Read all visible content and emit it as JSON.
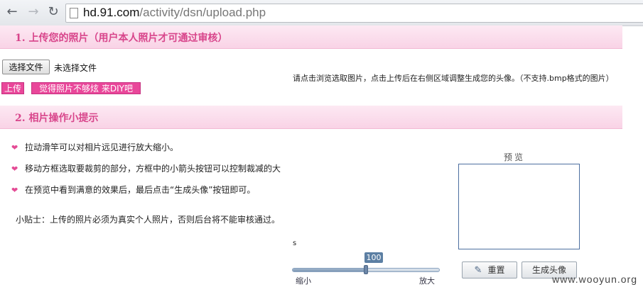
{
  "browser": {
    "url_domain": "hd.91.com",
    "url_path": "/activity/dsn/upload.php",
    "back_icon": "back-arrow",
    "forward_icon": "forward-arrow",
    "reload_icon": "reload"
  },
  "section1": {
    "title": "1. 上传您的照片（用户本人照片才可通过审核）"
  },
  "upload": {
    "choose_file_label": "选择文件",
    "file_status": "未选择文件",
    "upload_label": "上传",
    "diy_label": "觉得照片不够炫 来DIY吧",
    "hint": "请点击浏览选取图片，点击上传后在右侧区域调整生成您的头像。（不支持.bmp格式的图片）"
  },
  "section2": {
    "title": "2. 相片操作小提示"
  },
  "tips": [
    "拉动滑竿可以对相片远见进行放大缩小。",
    "移动方框选取要裁剪的部分，方框中的小箭头按钮可以控制裁减的大",
    "在预览中看到满意的效果后，最后点击“生成头像”按钮即可。"
  ],
  "note": "小贴士：上传的照片必须为真实个人照片，否则后台将不能审核通过。",
  "preview": {
    "label": "预览"
  },
  "slider": {
    "mark": "s",
    "value_label": "100",
    "fraction": 0.5,
    "min_label": "缩小",
    "max_label": "放大"
  },
  "buttons": {
    "reset_label": "重置",
    "generate_label": "生成头像"
  },
  "watermark": "www.wooyun.org",
  "colors": {
    "accent_pink": "#e9479a",
    "section_title": "#d8458b",
    "preview_border": "#4d6fa0",
    "slider_value_bg": "#5c7fa3"
  }
}
